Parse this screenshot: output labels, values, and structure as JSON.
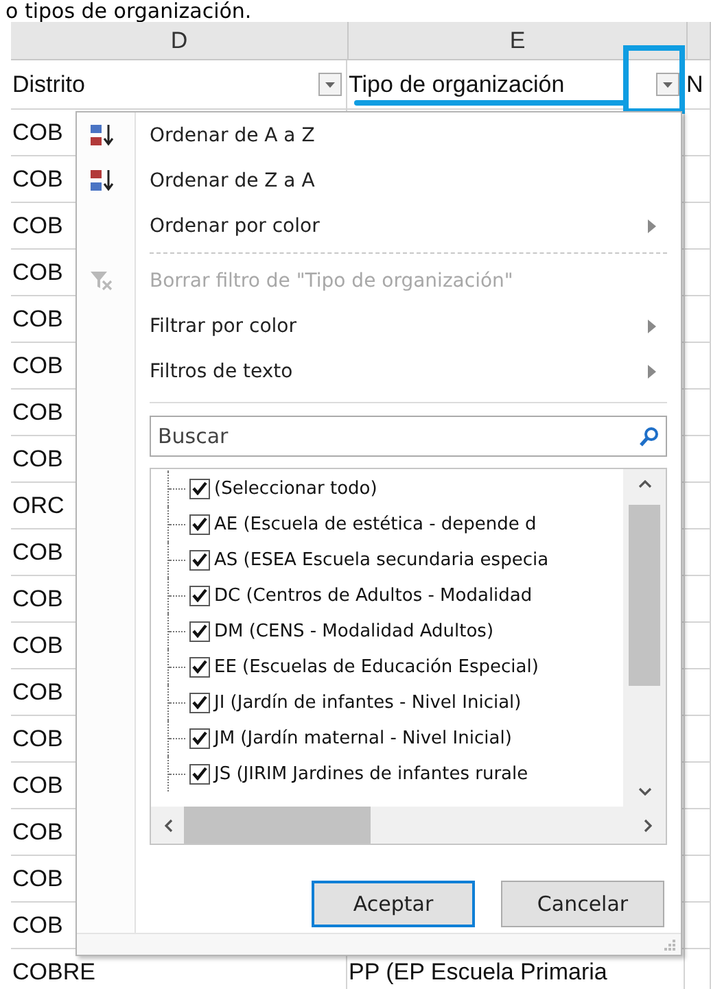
{
  "caption": "o tipos de organización.",
  "sheet": {
    "column_letters": [
      "D",
      "E"
    ],
    "headers": [
      {
        "label": "Distrito",
        "filter_button": true
      },
      {
        "label": "Tipo de organización",
        "filter_button": true
      },
      {
        "label": "N"
      }
    ],
    "rows": [
      {
        "column_d": "COB"
      },
      {
        "column_d": "COB"
      },
      {
        "column_d": "COB"
      },
      {
        "column_d": "COB"
      },
      {
        "column_d": "COB"
      },
      {
        "column_d": "COB"
      },
      {
        "column_d": "COB"
      },
      {
        "column_d": "COB"
      },
      {
        "column_d": "ORC"
      },
      {
        "column_d": "COB"
      },
      {
        "column_d": "COB"
      },
      {
        "column_d": "COB"
      },
      {
        "column_d": "COB"
      },
      {
        "column_d": "COB"
      },
      {
        "column_d": "COB"
      },
      {
        "column_d": "COB"
      },
      {
        "column_d": "COB"
      },
      {
        "column_d": "COB"
      },
      {
        "column_d": "COBRE",
        "column_e": "PP (EP Escuela Primaria"
      }
    ]
  },
  "filter_menu": {
    "items": [
      {
        "kind": "sort-asc",
        "label": "Ordenar de A a Z",
        "disabled": false
      },
      {
        "kind": "sort-desc",
        "label": "Ordenar de Z a A",
        "disabled": false
      },
      {
        "kind": "submenu",
        "label": "Ordenar por color",
        "disabled": false
      },
      {
        "kind": "separator"
      },
      {
        "kind": "clear-filter",
        "label": "Borrar filtro de \"Tipo de organización\"",
        "disabled": true
      },
      {
        "kind": "submenu",
        "label": "Filtrar por color",
        "disabled": false
      },
      {
        "kind": "submenu",
        "label": "Filtros de texto",
        "disabled": false
      }
    ],
    "search": {
      "placeholder": "Buscar"
    },
    "values": [
      {
        "label": "(Seleccionar todo)",
        "checked": true
      },
      {
        "label": "AE (Escuela de estética - depende d",
        "checked": true
      },
      {
        "label": "AS (ESEA Escuela secundaria especia",
        "checked": true
      },
      {
        "label": "DC (Centros de Adultos - Modalidad",
        "checked": true
      },
      {
        "label": "DM (CENS - Modalidad Adultos)",
        "checked": true
      },
      {
        "label": "EE (Escuelas de Educación Especial)",
        "checked": true
      },
      {
        "label": "JI (Jardín de infantes - Nivel Inicial)",
        "checked": true
      },
      {
        "label": "JM (Jardín maternal - Nivel Inicial)",
        "checked": true
      },
      {
        "label": "JS (JIRIM Jardines de infantes rurale",
        "checked": true
      }
    ],
    "buttons": [
      {
        "label": "Aceptar",
        "focused": true
      },
      {
        "label": "Cancelar",
        "focused": false
      }
    ]
  }
}
